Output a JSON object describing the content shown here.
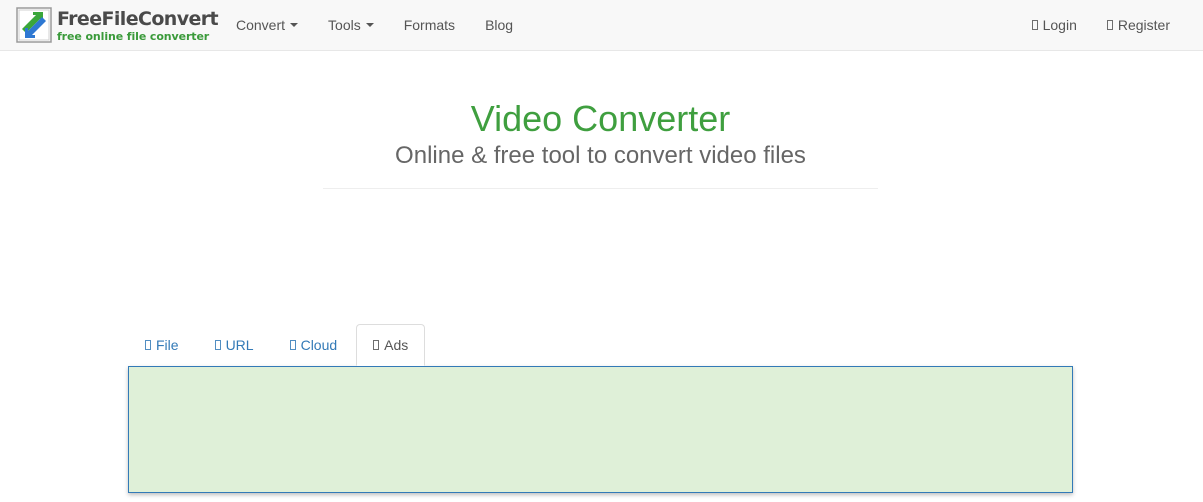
{
  "brand": {
    "name": "FreeFileConvert",
    "tagline": "free online file converter",
    "icon": "arrows-convert-icon",
    "colors": {
      "green": "#3f9f3f",
      "blue": "#337ab7"
    }
  },
  "nav": {
    "left": [
      {
        "label": "Convert",
        "dropdown": true
      },
      {
        "label": "Tools",
        "dropdown": true
      },
      {
        "label": "Formats",
        "dropdown": false
      },
      {
        "label": "Blog",
        "dropdown": false
      }
    ],
    "right": [
      {
        "label": "Login",
        "icon": "user-icon"
      },
      {
        "label": "Register",
        "icon": "user-plus-icon"
      }
    ]
  },
  "header": {
    "title": "Video Converter",
    "subtitle": "Online & free tool to convert video files"
  },
  "tabs": [
    {
      "label": "File",
      "icon": "file-icon",
      "active": false
    },
    {
      "label": "URL",
      "icon": "link-icon",
      "active": false
    },
    {
      "label": "Cloud",
      "icon": "cloud-icon",
      "active": false
    },
    {
      "label": "Ads",
      "icon": "ads-icon",
      "active": true
    }
  ],
  "panel": {
    "background": "#dff0d8",
    "border": "#337ab7"
  }
}
